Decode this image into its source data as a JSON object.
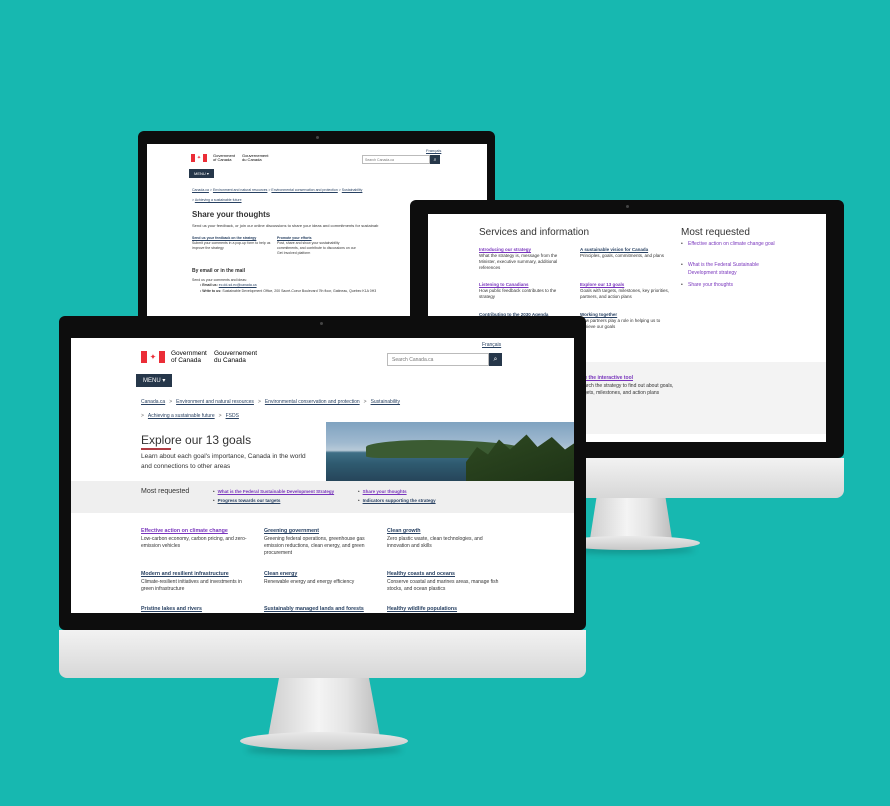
{
  "gov": {
    "en_line1": "Government",
    "en_line2": "of Canada",
    "fr_line1": "Gouvernement",
    "fr_line2": "du Canada",
    "lang_toggle": "Français",
    "search_placeholder": "Search Canada.ca",
    "menu_label": "MENU"
  },
  "share_page": {
    "breadcrumb_1": "Canada.ca",
    "breadcrumb_2": "Environment and natural resources",
    "breadcrumb_3": "Environmental conservation and protection",
    "breadcrumb_4": "Sustainability",
    "breadcrumb_5": "Achieving a sustainable future",
    "title": "Share your thoughts",
    "intro": "Send us your feedback, or join our online discussions to share your ideas and commitments for sustainab",
    "col1_link": "Send us your feedback on the strategy",
    "col1_text": "Submit your comments in a pop-up form to help us improve the strategy",
    "col2_link": "Promote your efforts",
    "col2_text": "Post, share and show your sustainability commitments, and contribute to discussions on our Get Involved platform",
    "mail_heading": "By email or in the mail",
    "mail_intro": "Send us your comments and ideas:",
    "email_label": "Email us:",
    "email_value": "ec.dd-sd.ec@canada.ca",
    "write_label": "Write to us:",
    "write_value": "Sustainable Development Office, 200 Sacré-Coeur Boulevard 7th floor, Gatineau, Quebec K1A 0H3"
  },
  "services_page": {
    "services_title": "Services and information",
    "most_requested_title": "Most requested",
    "svc": [
      {
        "link": "Introducing our strategy",
        "text": "What the strategy is, message from the Minister, executive summary, additional references"
      },
      {
        "link": "A sustainable vision for Canada",
        "text": "Principles, goals, commitments, and plans"
      },
      {
        "link": "Listening to Canadians",
        "text": "How public feedback contributes to the strategy"
      },
      {
        "link": "Explore our 13 goals",
        "text": "Goals with targets, milestones, key priorities, partners, and action plans"
      },
      {
        "link": "Contributing to the 2030 Agenda",
        "text": ""
      },
      {
        "link": "Working together",
        "text": "How partners play a role in helping us to achieve our goals"
      }
    ],
    "req": [
      "Effective action on climate change goal",
      "What is the Federal Sustainable Development strategy",
      "Share your thoughts"
    ],
    "tool_link": "Use the interactive tool",
    "tool_text": "Search the strategy to find out about goals, targets, milestones, and action plans"
  },
  "goals_page": {
    "breadcrumb_1": "Canada.ca",
    "breadcrumb_2": "Environment and natural resources",
    "breadcrumb_3": "Environmental conservation and protection",
    "breadcrumb_4": "Sustainability",
    "breadcrumb_5": "Achieving a sustainable future",
    "breadcrumb_6": "FSDS",
    "title": "Explore our 13 goals",
    "intro": "Learn about each goal's importance, Canada in the world and connections to other areas",
    "most_requested": "Most requested",
    "mr_links": [
      "What is the Federal Sustainable Development Strategy",
      "Progress towards our targets",
      "Share your thoughts",
      "Indicators supporting the strategy"
    ],
    "goals": [
      {
        "link": "Effective action on climate change",
        "text": "Low-carbon economy, carbon pricing, and zero-emission vehicles"
      },
      {
        "link": "Greening government",
        "text": "Greening federal operations, greenhouse gas emission reductions, clean energy, and green procurement"
      },
      {
        "link": "Clean growth",
        "text": "Zero plastic waste, clean technologies, and innovation and skills"
      },
      {
        "link": "Modern and resilient infrastructure",
        "text": "Climate-resilient initiatives and investments in green infrastructure"
      },
      {
        "link": "Clean energy",
        "text": "Renewable energy and energy efficiency"
      },
      {
        "link": "Healthy coasts and oceans",
        "text": "Conserve coastal and marines areas, manage fish stocks, and ocean plastics"
      },
      {
        "link": "Pristine lakes and rivers",
        "text": ""
      },
      {
        "link": "Sustainably managed lands and forests",
        "text": ""
      },
      {
        "link": "Healthy wildlife populations",
        "text": ""
      }
    ]
  },
  "colors": {
    "background": "#17b8b0",
    "gov_navy": "#26374a",
    "link": "#284162",
    "visited_link": "#7834bc",
    "flag_red": "#eb2d37"
  }
}
